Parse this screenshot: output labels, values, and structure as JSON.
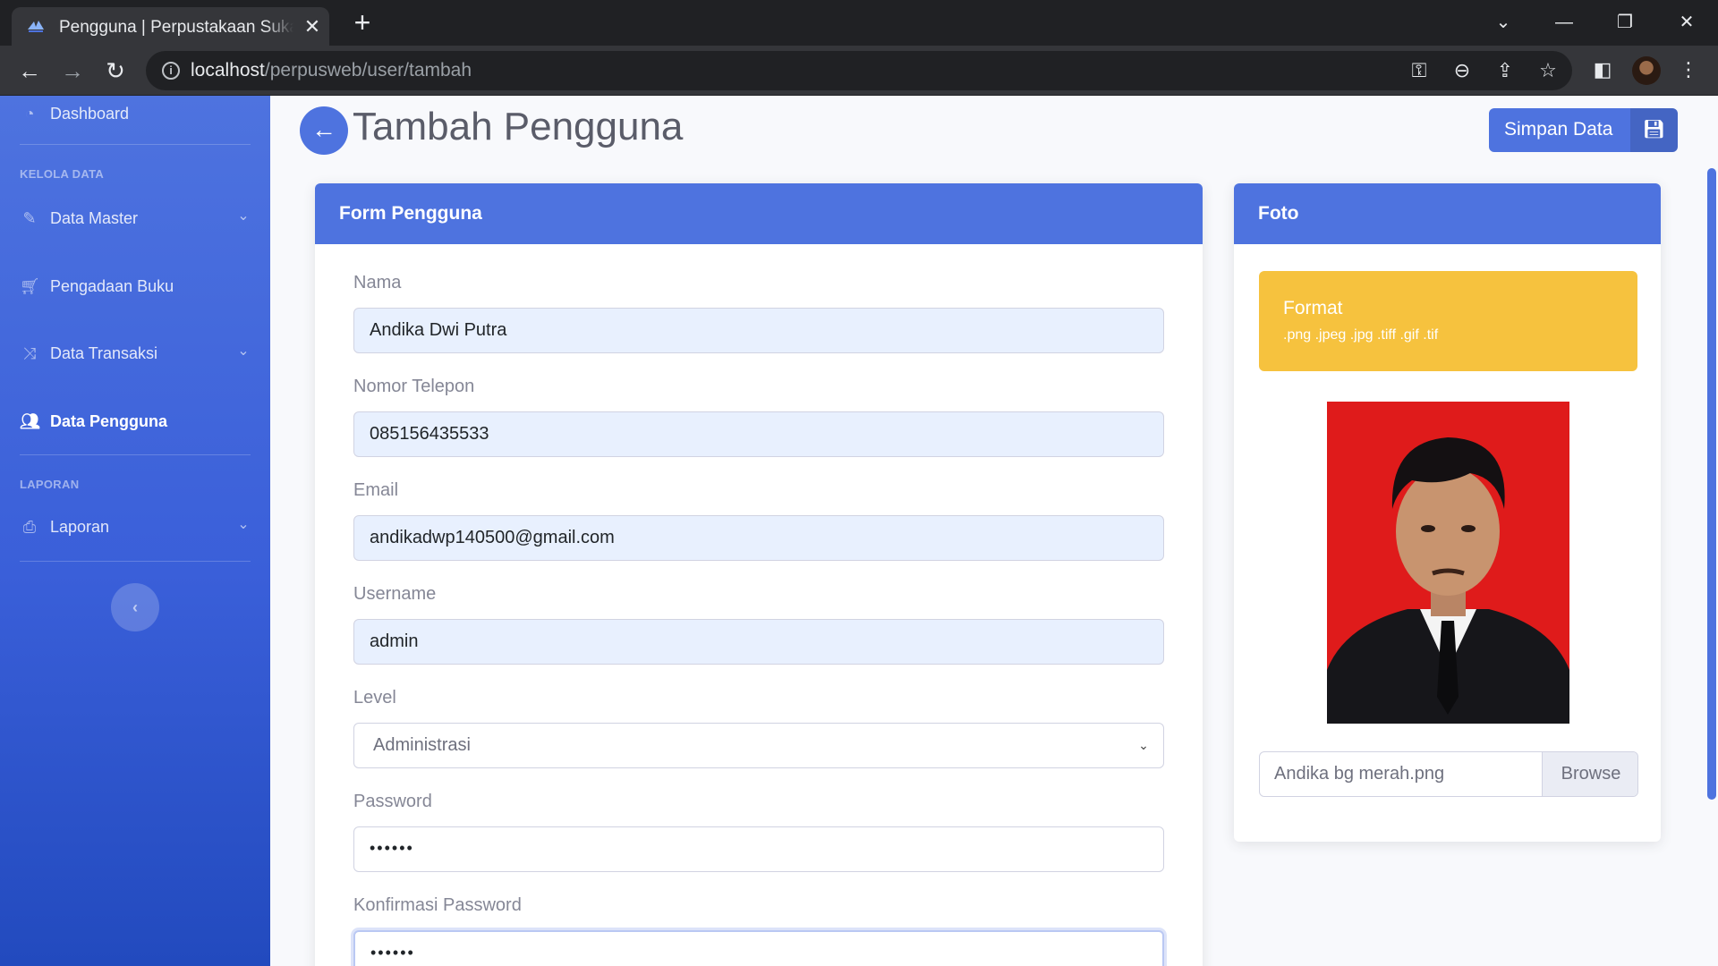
{
  "browser": {
    "tab_title": "Pengguna | Perpustakaan Suka Suka",
    "url_host": "localhost",
    "url_path": "/perpusweb/user/tambah",
    "icons": {
      "tab_close": "close-icon",
      "new_tab": "plus-icon",
      "back": "arrow-left-icon",
      "forward": "arrow-right-icon",
      "reload": "reload-icon",
      "site_info": "info-icon",
      "key": "key-icon",
      "zoom": "zoom-out-icon",
      "share": "share-icon",
      "bookmark": "star-icon",
      "side_panel": "side-panel-icon",
      "menu": "kebab-menu-icon"
    }
  },
  "sidebar": {
    "dashboard": "Dashboard",
    "heading_kelola": "KELOLA DATA",
    "data_master": "Data Master",
    "pengadaan_buku": "Pengadaan Buku",
    "data_transaksi": "Data Transaksi",
    "data_pengguna": "Data Pengguna",
    "heading_laporan": "LAPORAN",
    "laporan": "Laporan",
    "active_item": "Data Pengguna"
  },
  "header": {
    "title": "Tambah Pengguna",
    "save_label": "Simpan Data"
  },
  "form": {
    "card_title": "Form Pengguna",
    "nama_label": "Nama",
    "nama_value": "Andika Dwi Putra",
    "telepon_label": "Nomor Telepon",
    "telepon_value": "085156435533",
    "email_label": "Email",
    "email_value": "andikadwp140500@gmail.com",
    "username_label": "Username",
    "username_value": "admin",
    "level_label": "Level",
    "level_value": "Administrasi",
    "password_label": "Password",
    "password_value": "••••••",
    "konfirmasi_label": "Konfirmasi Password",
    "konfirmasi_value": "••••••"
  },
  "foto": {
    "card_title": "Foto",
    "format_heading": "Format",
    "format_list": ".png .jpeg .jpg .tiff .gif .tif",
    "file_name": "Andika bg merah.png",
    "browse_label": "Browse"
  },
  "colors": {
    "primary": "#4e73df",
    "warning": "#f6c23e",
    "photo_background": "#df1b1b",
    "input_autofill": "#e8f0fe"
  }
}
